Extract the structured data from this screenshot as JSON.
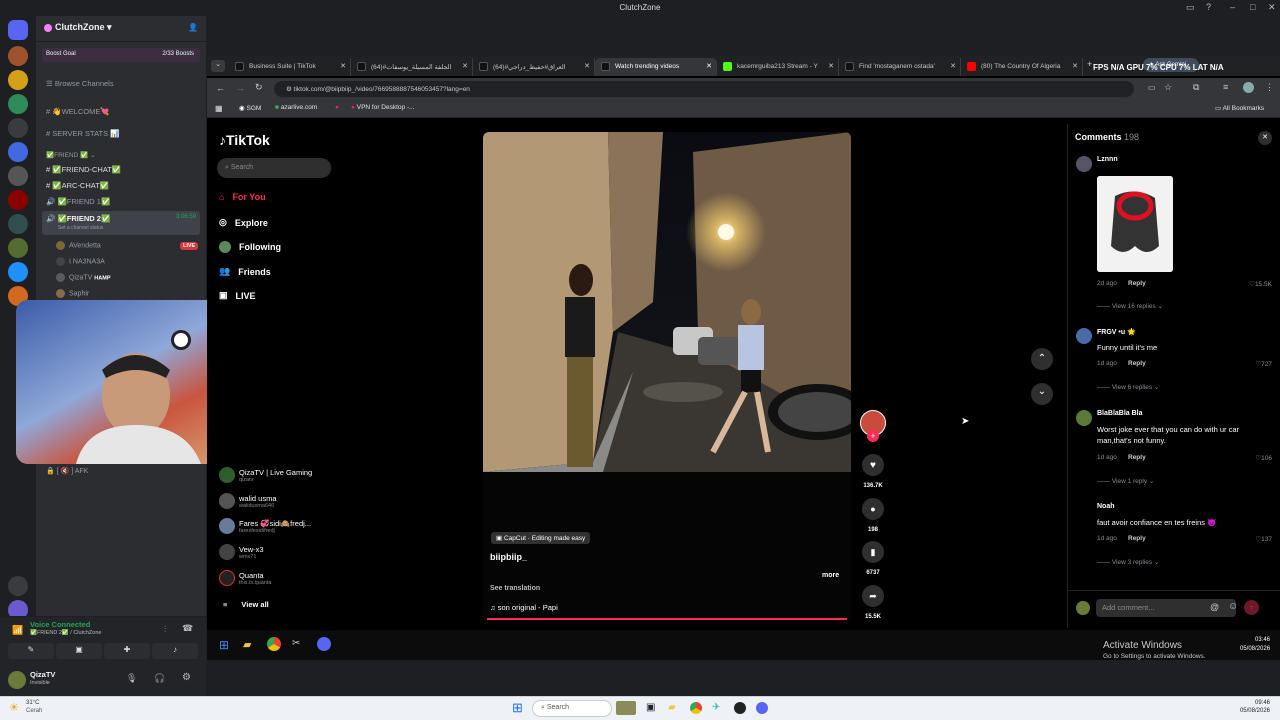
{
  "window": {
    "title": "ClutchZone"
  },
  "server": {
    "name": "ClutchZone",
    "boost_goal": "Boost Goal",
    "boosts": "2/33 Boosts"
  },
  "channels": [
    {
      "label": "Browse Channels",
      "icon": "browse-icon"
    },
    {
      "label": "👋WELCOME💘",
      "icon": "hash-icon"
    },
    {
      "label": "SERVER STATS 📊",
      "icon": "hash-icon"
    },
    {
      "label": "✅FRIEND ✅",
      "icon": "category-icon"
    },
    {
      "label": "✅FRIEND-CHAT✅",
      "icon": "hash-icon"
    },
    {
      "label": "✅ARC-CHAT✅",
      "icon": "hash-icon"
    },
    {
      "label": "✅FRIEND 1✅",
      "icon": "speaker-icon"
    },
    {
      "label": "✅FRIEND 2✅",
      "icon": "speaker-icon",
      "timer": "3:06:59",
      "status": "Set a channel status"
    }
  ],
  "voice_users": [
    {
      "name": "AVendetta",
      "badge": "LIVE"
    },
    {
      "name": "I NA3NA3A",
      "badge": ""
    },
    {
      "name": "QizaTV",
      "badge": "HAMP"
    },
    {
      "name": "Saphir",
      "badge": ""
    }
  ],
  "afk_channel": "[ 🔇 ] AFK",
  "voice_panel": {
    "status": "Voice Connected",
    "channel": "✅FRIEND 2✅ / ClutchZone"
  },
  "user_panel": {
    "name": "QizaTV",
    "status": "Invisible"
  },
  "tabs": [
    {
      "label": "Business Suite | TikTok",
      "fav": "#fff"
    },
    {
      "label": "الجلفة المسيلة_يوسفات#(64)",
      "fav": "#fff"
    },
    {
      "label": "العراق#حفيظ_دراجي#(64)",
      "fav": "#fff"
    },
    {
      "label": "Watch trending videos",
      "fav": "#fff"
    },
    {
      "label": "kacemrguiba213 Stream - Y",
      "fav": "#53fc18"
    },
    {
      "label": "Find 'mostaganem ostada'",
      "fav": "#fff"
    },
    {
      "label": "(80) The Country Of Algeria",
      "fav": "#ff0000"
    }
  ],
  "overlay_stats": "FPS N/A  GPU 7%  CPU 7%  LAT N/A",
  "ask_gemini": "Ask Gemini",
  "address": {
    "url": "tiktok.com/@biipbiip_/video/7669588887546053457?lang=en"
  },
  "bookmarks": [
    "SGM",
    "azarlive.com",
    "VPN for Desktop -..."
  ],
  "all_bookmarks": "All Bookmarks",
  "tiktok": {
    "logo": "TikTok",
    "search_placeholder": "Search",
    "nav": [
      {
        "label": "For You",
        "icon": "home-icon",
        "active": true
      },
      {
        "label": "Explore",
        "icon": "compass-icon",
        "active": false
      },
      {
        "label": "Following",
        "icon": "following-icon",
        "active": false
      },
      {
        "label": "Friends",
        "icon": "friends-icon",
        "active": false
      },
      {
        "label": "LIVE",
        "icon": "live-icon",
        "active": false
      }
    ],
    "following_accounts": [
      {
        "name": "QizaTV | Live Gaming",
        "handle": "qizatv"
      },
      {
        "name": "walid usma",
        "handle": "walidusma646"
      },
      {
        "name": "Fares 💞sidi🙈fredj...",
        "handle": "faresfesidifredj"
      },
      {
        "name": "Vew-x3",
        "handle": "wmx71"
      },
      {
        "name": "Quanta",
        "handle": "this.is.quanta"
      }
    ],
    "view_all": "View all",
    "video": {
      "capcut": "CapCut · Editing made easy",
      "author": "biipbiip_",
      "see_translation": "See translation",
      "sound": "son original - Papi",
      "more": "more",
      "progress": 1.0
    },
    "actions": {
      "likes": "136.7K",
      "comments": "198",
      "saves": "6737",
      "shares": "15.5K"
    },
    "comments_header": {
      "label": "Comments",
      "count": "198"
    },
    "comments": [
      {
        "name": "Lznnn",
        "text": "",
        "meta": "2d ago",
        "reply": "Reply",
        "likes": "15.5K",
        "replies": "View 16 replies",
        "has_image": true
      },
      {
        "name": "FRGV •u 🌟",
        "text": "Funny until it's me",
        "meta": "1d ago",
        "reply": "Reply",
        "likes": "727",
        "replies": "View 6 replies"
      },
      {
        "name": "BlaBlaBla Bla",
        "text": "Worst joke ever that you can do with ur car man,that's not funny.",
        "meta": "1d ago",
        "reply": "Reply",
        "likes": "106",
        "replies": "View 1 reply"
      },
      {
        "name": "Noah",
        "text": "faut avoir confiance en tes freins 😈",
        "meta": "1d ago",
        "reply": "Reply",
        "likes": "137",
        "replies": "View 3 replies"
      }
    ],
    "add_comment_placeholder": "Add comment..."
  },
  "activate_windows": {
    "title": "Activate Windows",
    "sub": "Go to Settings to activate Windows."
  },
  "tray_clock": {
    "time": "03:46",
    "date": "05/08/2026"
  },
  "taskbar": {
    "search": "Search",
    "weather_temp": "31°C",
    "weather_desc": "Cerah",
    "time": "09:46",
    "date": "05/08/2026"
  }
}
